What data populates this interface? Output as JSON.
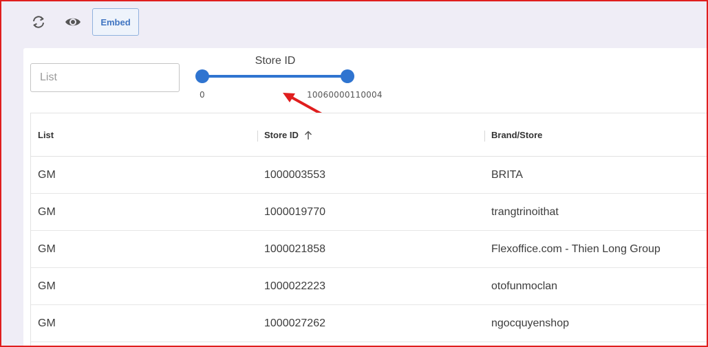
{
  "toolbar": {
    "refresh_icon": "refresh-icon",
    "preview_icon": "eye-icon",
    "embed_label": "Embed"
  },
  "filters": {
    "list_placeholder": "List",
    "range": {
      "label": "Store ID",
      "min_label": "0",
      "max_label": "10060000110004",
      "selected_from_fraction": 0,
      "selected_to_fraction": 1
    }
  },
  "annotation": {
    "arrow_color": "#e01e1e"
  },
  "table": {
    "columns": [
      {
        "label": "List"
      },
      {
        "label": "Store ID",
        "sort": "ascending"
      },
      {
        "label": "Brand/Store"
      }
    ],
    "rows": [
      {
        "list": "GM",
        "store_id": "1000003553",
        "brand": "BRITA"
      },
      {
        "list": "GM",
        "store_id": "1000019770",
        "brand": "trangtrinoithat"
      },
      {
        "list": "GM",
        "store_id": "1000021858",
        "brand": "Flexoffice.com - Thien Long Group"
      },
      {
        "list": "GM",
        "store_id": "1000022223",
        "brand": "otofunmoclan"
      },
      {
        "list": "GM",
        "store_id": "1000027262",
        "brand": "ngocquyenshop"
      }
    ]
  },
  "colors": {
    "accent": "#2f74d0",
    "page_bg": "#efedf6",
    "frame_border": "#e01e1e"
  }
}
